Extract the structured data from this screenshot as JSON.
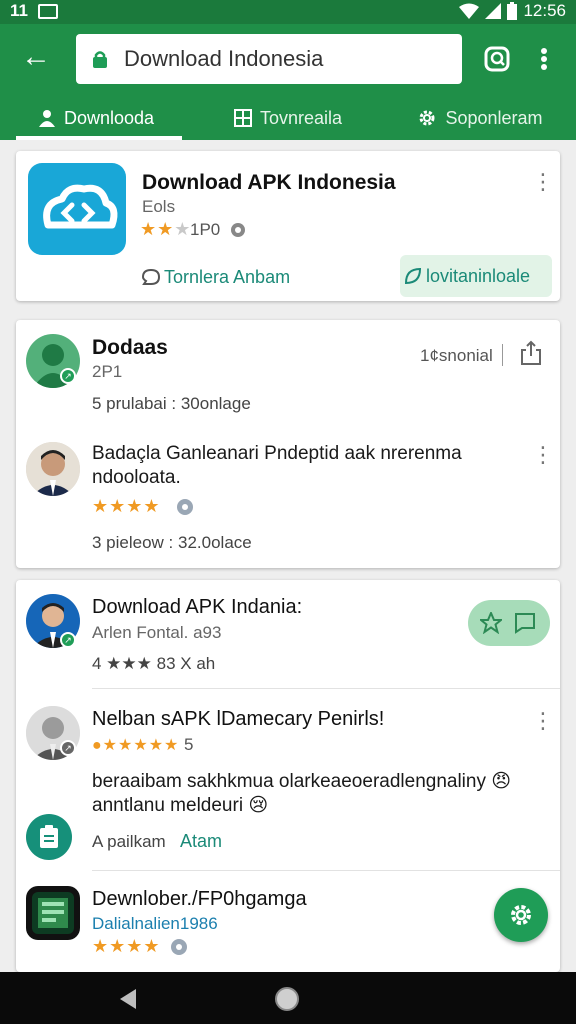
{
  "status_bar": {
    "time_left": "11",
    "time_right": "12:56"
  },
  "search": {
    "value": "Download Indonesia"
  },
  "tabs": [
    {
      "label": "Downlooda"
    },
    {
      "label": "Tovnreaila"
    },
    {
      "label": "Soponleram"
    }
  ],
  "featured": {
    "title": "Download APK Indonesia",
    "subtitle": "Eols",
    "rating_count": "1P0",
    "action_left": "Tornlera Anbam",
    "action_right": "lovitaninloale"
  },
  "card2": {
    "item1": {
      "title": "Dodaas",
      "subtitle": "2P1",
      "meta": "5 prulabai : 30onlage",
      "aside": "1¢snonial"
    },
    "item2": {
      "title": "Badaçla Ganleanari Pndeptid aak nrerenma ndooloata.",
      "meta": "3 pieleow : 32.0olace"
    }
  },
  "card3": {
    "item1": {
      "title": "Download APK Indania:",
      "subtitle": "Arlen Fontal. a93",
      "meta": "4 ★★★ 83 X ah"
    },
    "item2": {
      "title": "Nelban sAPK lDamecary Penirls!",
      "rating_suffix": "5",
      "body": "beraaibam sakhkmua olarkeaeoeradlengnaliny 😠 anntlanu meldeuri 😢",
      "action_prefix": "A pailkam",
      "action_link": "Atam"
    },
    "item3": {
      "title": "Dewnlober./FP0hgamga",
      "subtitle": "Dalialnalien1986"
    }
  },
  "colors": {
    "primary": "#1f8f48",
    "accent": "#1f9d57",
    "app_icon": "#19a7d7",
    "star": "#f09a23"
  }
}
